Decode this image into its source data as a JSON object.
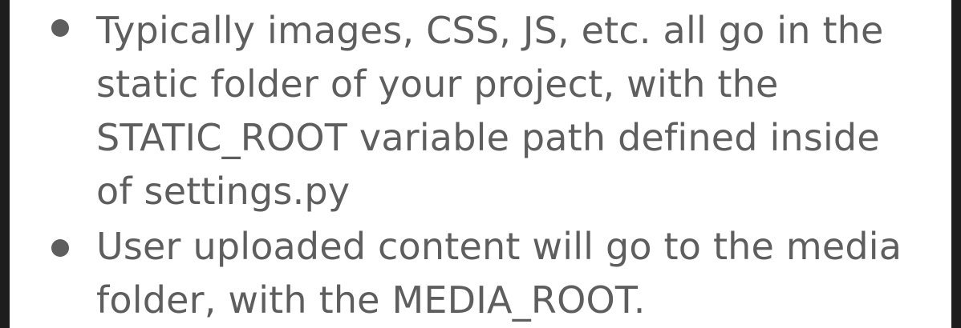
{
  "content": {
    "bullets": [
      {
        "text": "Typically images, CSS, JS, etc. all go in the static folder of your project, with the STATIC_ROOT variable path defined inside of settings.py"
      },
      {
        "text": "User uploaded content will go to the media folder, with the MEDIA_ROOT."
      }
    ]
  },
  "colors": {
    "text": "#5e5e5e",
    "background": "#ffffff",
    "frame": "#1d1d1d"
  }
}
